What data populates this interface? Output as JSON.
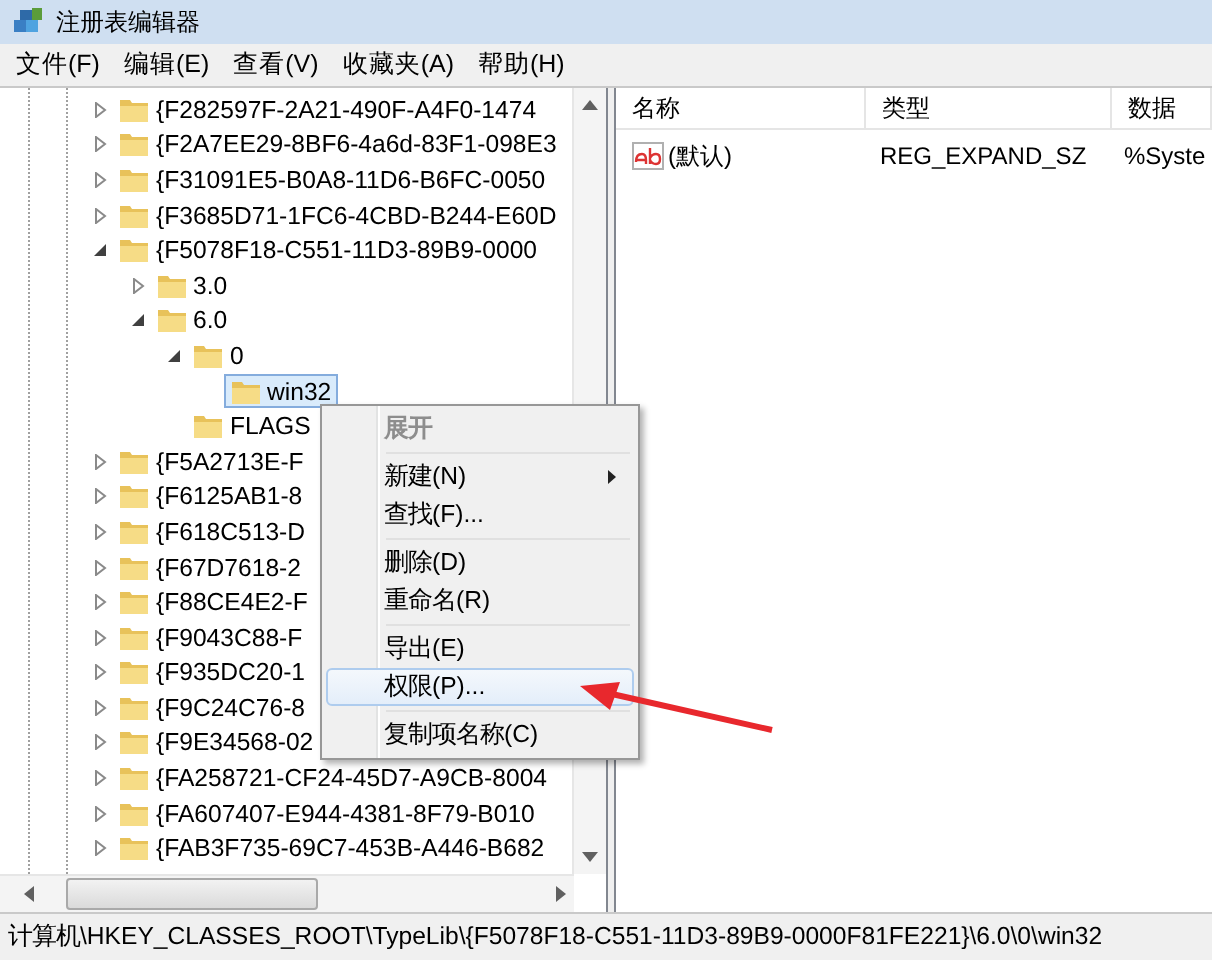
{
  "window": {
    "title": "注册表编辑器"
  },
  "menu_bar": [
    "文件(F)",
    "编辑(E)",
    "查看(V)",
    "收藏夹(A)",
    "帮助(H)"
  ],
  "tree": {
    "items": [
      {
        "label": "{F282597F-2A21-490F-A4F0-1474",
        "expandable": true,
        "expanded": false,
        "selected": false
      },
      {
        "label": "{F2A7EE29-8BF6-4a6d-83F1-098E3",
        "expandable": true,
        "expanded": false,
        "selected": false
      },
      {
        "label": "{F31091E5-B0A8-11D6-B6FC-0050",
        "expandable": true,
        "expanded": false,
        "selected": false
      },
      {
        "label": "{F3685D71-1FC6-4CBD-B244-E60D",
        "expandable": true,
        "expanded": false,
        "selected": false
      },
      {
        "label": "{F5078F18-C551-11D3-89B9-0000",
        "expandable": true,
        "expanded": true,
        "selected": false,
        "children": [
          {
            "label": "3.0",
            "expandable": true,
            "expanded": false,
            "selected": false
          },
          {
            "label": "6.0",
            "expandable": true,
            "expanded": true,
            "selected": false,
            "children": [
              {
                "label": "0",
                "expandable": true,
                "expanded": true,
                "selected": false,
                "children": [
                  {
                    "label": "win32",
                    "expandable": false,
                    "expanded": false,
                    "selected": true
                  }
                ]
              },
              {
                "label": "FLAGS",
                "expandable": false,
                "expanded": false,
                "selected": false
              }
            ]
          }
        ]
      },
      {
        "label": "{F5A2713E-F",
        "expandable": true,
        "expanded": false,
        "selected": false
      },
      {
        "label": "{F6125AB1-8",
        "expandable": true,
        "expanded": false,
        "selected": false
      },
      {
        "label": "{F618C513-D",
        "expandable": true,
        "expanded": false,
        "selected": false
      },
      {
        "label": "{F67D7618-2",
        "expandable": true,
        "expanded": false,
        "selected": false
      },
      {
        "label": "{F88CE4E2-F",
        "expandable": true,
        "expanded": false,
        "selected": false
      },
      {
        "label": "{F9043C88-F",
        "expandable": true,
        "expanded": false,
        "selected": false
      },
      {
        "label": "{F935DC20-1",
        "expandable": true,
        "expanded": false,
        "selected": false
      },
      {
        "label": "{F9C24C76-8",
        "expandable": true,
        "expanded": false,
        "selected": false
      },
      {
        "label": "{F9E34568-02",
        "expandable": true,
        "expanded": false,
        "selected": false
      },
      {
        "label": "{FA258721-CF24-45D7-A9CB-8004",
        "expandable": true,
        "expanded": false,
        "selected": false
      },
      {
        "label": "{FA607407-E944-4381-8F79-B010",
        "expandable": true,
        "expanded": false,
        "selected": false
      },
      {
        "label": "{FAB3F735-69C7-453B-A446-B682",
        "expandable": true,
        "expanded": false,
        "selected": false
      }
    ]
  },
  "values": {
    "columns": [
      "名称",
      "类型",
      "数据"
    ],
    "rows": [
      {
        "name": "(默认)",
        "type": "REG_EXPAND_SZ",
        "data": "%Syste"
      }
    ]
  },
  "context_menu": [
    {
      "kind": "item",
      "label": "展开",
      "disabled": true,
      "selected": false,
      "submenu": false
    },
    {
      "kind": "separator"
    },
    {
      "kind": "item",
      "label": "新建(N)",
      "disabled": false,
      "selected": false,
      "submenu": true
    },
    {
      "kind": "item",
      "label": "查找(F)...",
      "disabled": false,
      "selected": false,
      "submenu": false
    },
    {
      "kind": "separator"
    },
    {
      "kind": "item",
      "label": "删除(D)",
      "disabled": false,
      "selected": false,
      "submenu": false
    },
    {
      "kind": "item",
      "label": "重命名(R)",
      "disabled": false,
      "selected": false,
      "submenu": false
    },
    {
      "kind": "separator"
    },
    {
      "kind": "item",
      "label": "导出(E)",
      "disabled": false,
      "selected": false,
      "submenu": false
    },
    {
      "kind": "item",
      "label": "权限(P)...",
      "disabled": false,
      "selected": true,
      "submenu": false
    },
    {
      "kind": "separator"
    },
    {
      "kind": "item",
      "label": "复制项名称(C)",
      "disabled": false,
      "selected": false,
      "submenu": false
    }
  ],
  "status_bar": "计算机\\HKEY_CLASSES_ROOT\\TypeLib\\{F5078F18-C551-11D3-89B9-0000F81FE221}\\6.0\\0\\win32"
}
